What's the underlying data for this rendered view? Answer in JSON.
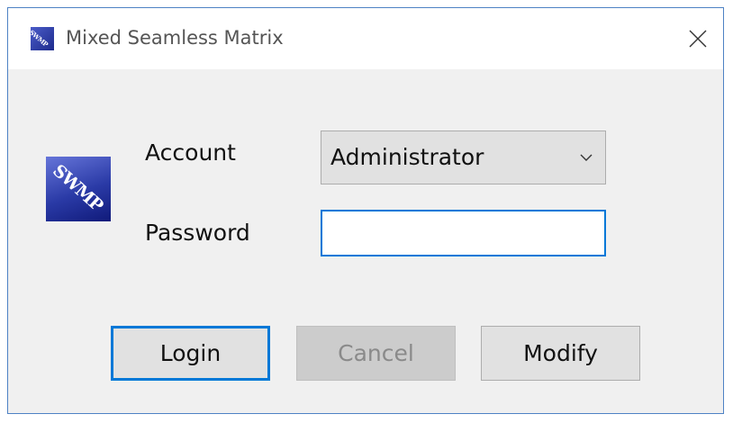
{
  "window": {
    "title": "Mixed Seamless Matrix",
    "icon_text": "SWMP",
    "close_icon": "close-icon"
  },
  "logo": {
    "text": "SWMP"
  },
  "form": {
    "account_label": "Account",
    "account_value": "Administrator",
    "password_label": "Password",
    "password_value": ""
  },
  "buttons": {
    "login": "Login",
    "cancel": "Cancel",
    "modify": "Modify"
  },
  "colors": {
    "accent": "#0078d7",
    "window_bg": "#f0f0f0",
    "logo_blue": "#2a3aa6"
  }
}
